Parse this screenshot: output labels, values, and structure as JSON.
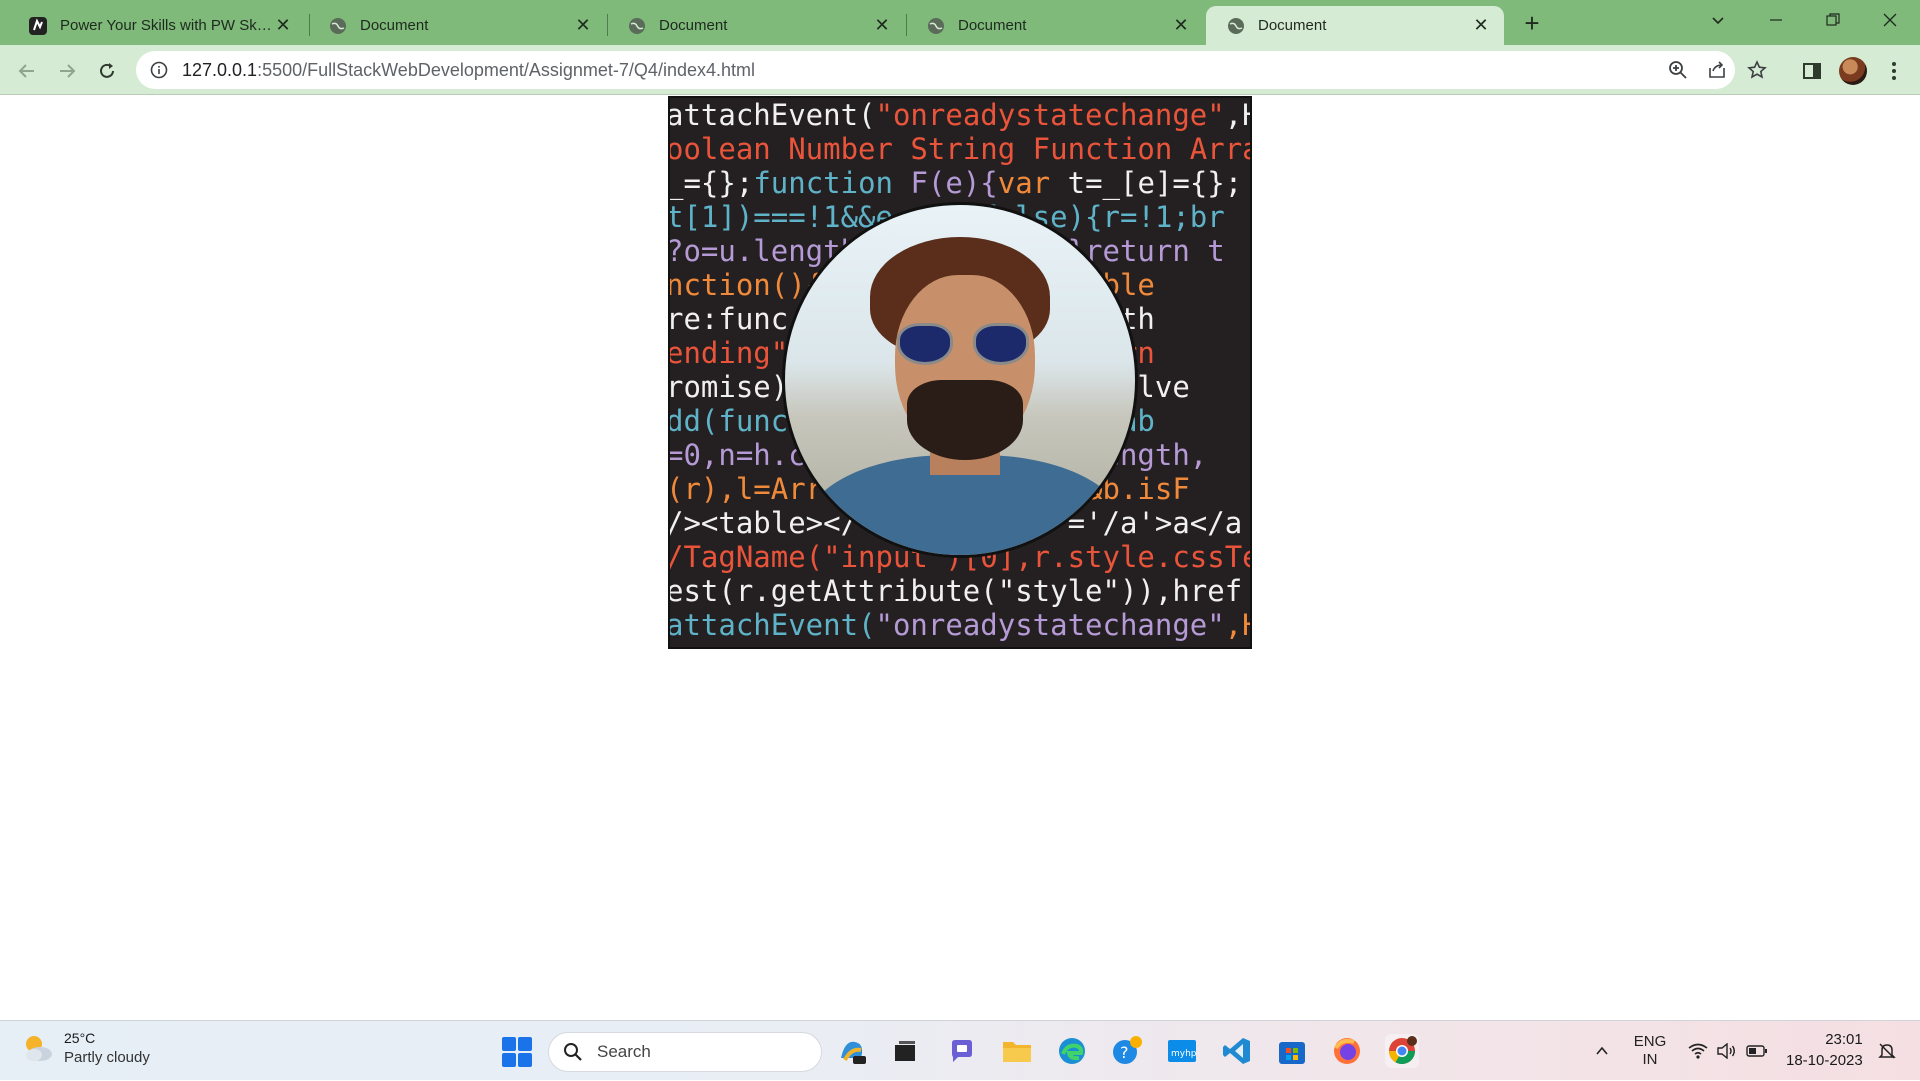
{
  "browser": {
    "tabs": [
      {
        "title": "Power Your Skills with PW Skills",
        "favicon": "pw-skills-icon",
        "active": false
      },
      {
        "title": "Document",
        "favicon": "globe-icon",
        "active": false
      },
      {
        "title": "Document",
        "favicon": "globe-icon",
        "active": false
      },
      {
        "title": "Document",
        "favicon": "globe-icon",
        "active": false
      },
      {
        "title": "Document",
        "favicon": "globe-icon",
        "active": true
      }
    ],
    "tab_close_glyph": "✕",
    "new_tab_glyph": "+",
    "address": {
      "host": "127.0.0.1",
      "path": ":5500/FullStackWebDevelopment/Assignmet-7/Q4/index4.html"
    }
  },
  "page": {
    "code_background_lines": [
      [
        "attachEvent(",
        "\"onreadystatechange\"",
        ",H"
      ],
      [
        "oolean Number String Function Arra"
      ],
      [
        "_={};",
        "function",
        " F(e){",
        "var",
        " t=_[e]={};"
      ],
      [
        "t[1])===!1&&e     false){r=!1;br"
      ],
      [
        "?o=u.length           )}return t"
      ],
      [
        "nction(){          },disable"
      ],
      [
        "re:func              With(th"
      ],
      [
        "ending\"              {return"
      ],
      [
        "romise)                resolve"
      ],
      [
        "dd(func              ].disab"
      ],
      [
        "=0,n=h.c               .length,"
      ],
      [
        "(r),l=Arr            c]&&b.isF"
      ],
      [
        "/><table></            ='/a'>a</a"
      ],
      [
        "/TagName(\"input\")[0],r.style.cssTe"
      ],
      [
        "est(r.getAttribute(\"style\")),href"
      ],
      [
        "attachEvent(",
        "\"onreadystatechange\"",
        ",H"
      ]
    ]
  },
  "taskbar": {
    "weather": {
      "temp": "25°C",
      "condition": "Partly cloudy"
    },
    "search_placeholder": "Search",
    "language": {
      "line1": "ENG",
      "line2": "IN"
    },
    "clock": {
      "time": "23:01",
      "date": "18-10-2023"
    }
  }
}
